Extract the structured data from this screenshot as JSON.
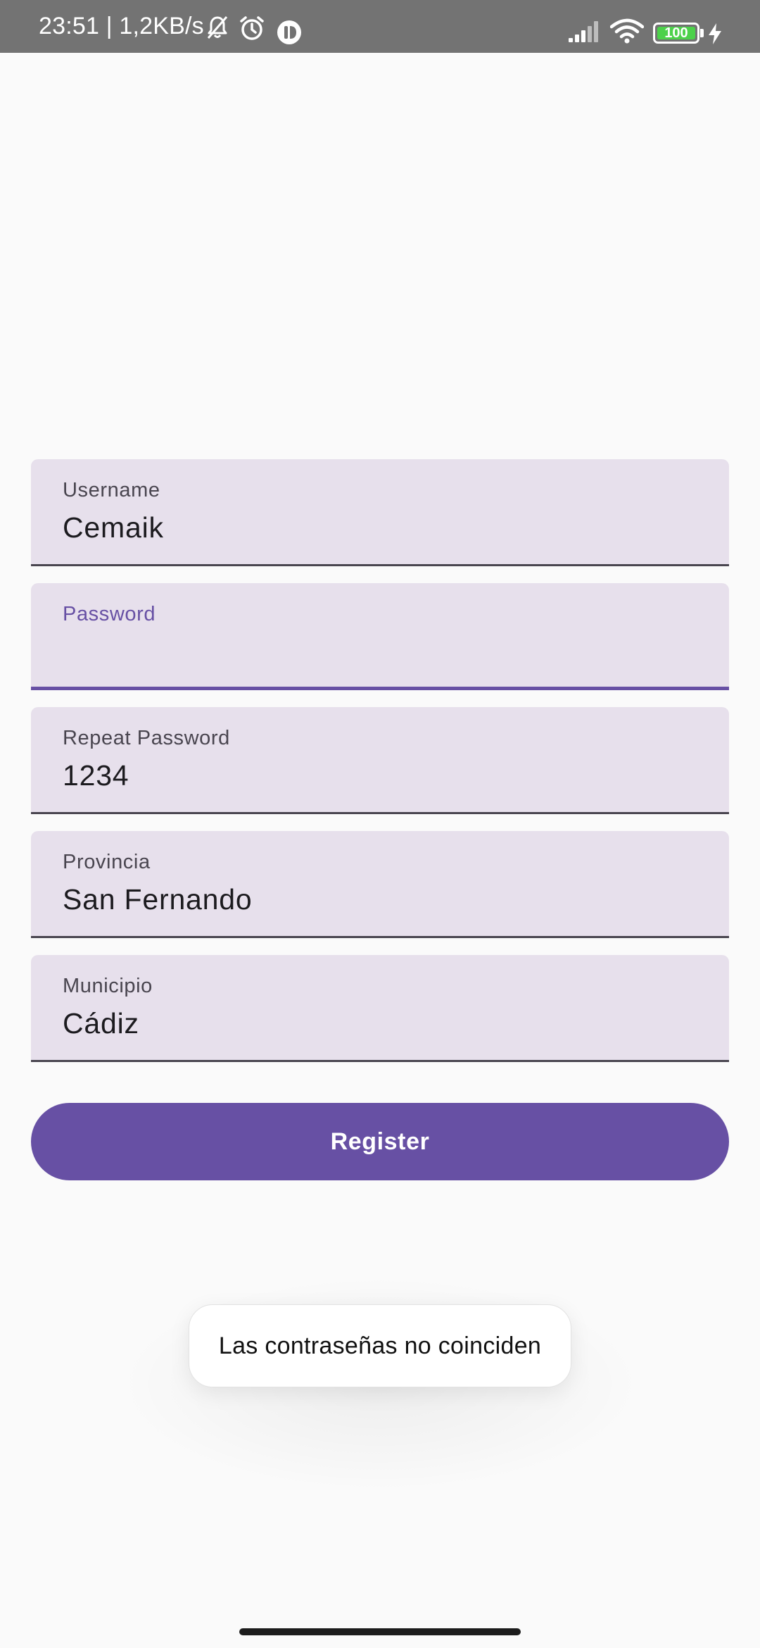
{
  "status_bar": {
    "time_and_speed": "23:51 | 1,2KB/s",
    "battery_level": "100",
    "icons": [
      "bell-off-icon",
      "alarm-icon",
      "app-notification-icon",
      "signal-icon",
      "wifi-icon",
      "battery-icon",
      "charging-icon"
    ]
  },
  "form": {
    "username": {
      "label": "Username",
      "value": "Cemaik"
    },
    "password": {
      "label": "Password",
      "value": ""
    },
    "repeat_password": {
      "label": "Repeat Password",
      "value": "1234"
    },
    "provincia": {
      "label": "Provincia",
      "value": "San Fernando"
    },
    "municipio": {
      "label": "Municipio",
      "value": "Cádiz"
    },
    "register_label": "Register"
  },
  "toast": {
    "message": "Las contraseñas no coinciden"
  },
  "colors": {
    "accent": "#6750a4",
    "field_background": "#e7e0ec",
    "page_background": "#fafafa",
    "status_bar": "#737373",
    "battery_fill": "#4cd14a"
  }
}
